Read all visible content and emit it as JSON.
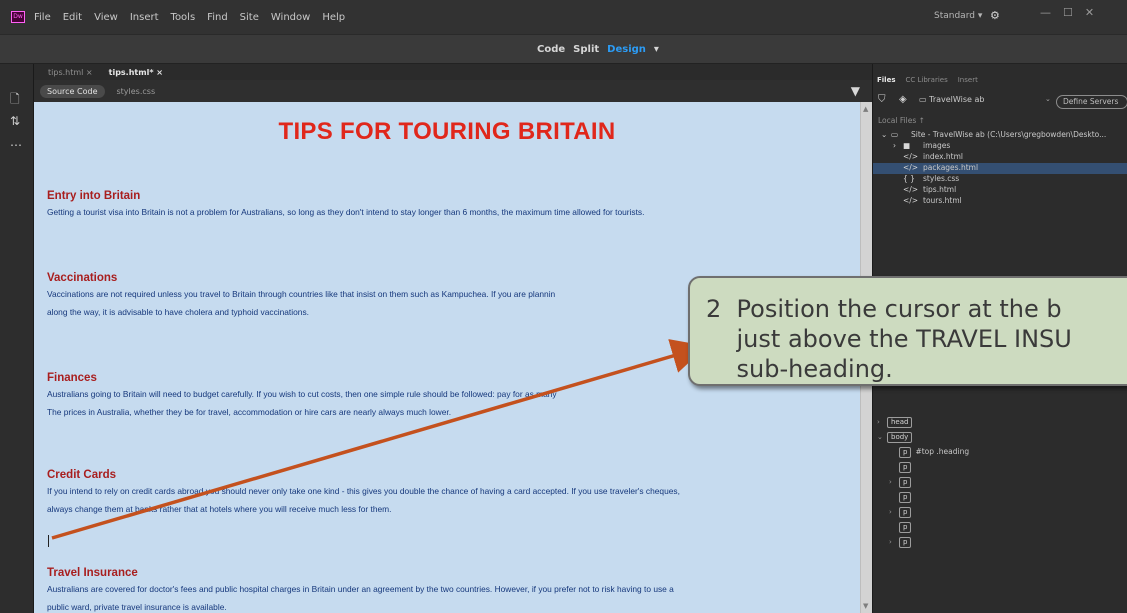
{
  "menubar": {
    "logo": "Dw",
    "items": [
      "File",
      "Edit",
      "View",
      "Insert",
      "Tools",
      "Find",
      "Site",
      "Window",
      "Help"
    ],
    "workspace": "Standard",
    "gear": "⚙"
  },
  "viewbar": {
    "code": "Code",
    "split": "Split",
    "design": "Design"
  },
  "doc": {
    "tabs": [
      "tips.html",
      "tips.html*"
    ],
    "related": {
      "source": "Source Code",
      "styles": "styles.css"
    },
    "title": "TIPS FOR TOURING BRITAIN",
    "sections": [
      {
        "heading": "Entry into Britain",
        "lines": [
          "Getting a tourist visa into Britain is not a problem for Australians, so long as they don't intend to stay longer than 6 months, the maximum time allowed for tourists."
        ]
      },
      {
        "heading": "Vaccinations",
        "lines": [
          "Vaccinations are not required unless you travel to Britain through countries like that insist on them such as Kampuchea. If you are plannin",
          "along the way, it is advisable to have cholera and typhoid vaccinations."
        ]
      },
      {
        "heading": "Finances",
        "lines": [
          "Australians going to Britain will need to budget carefully. If you wish to cut costs, then one simple rule should be followed: pay for as many",
          "The prices in Australia, whether they be for travel, accommodation or hire cars are nearly always much lower."
        ]
      },
      {
        "heading": "Credit Cards",
        "lines": [
          "If you intend to rely on credit cards abroad you should never only take one kind - this gives you double the chance of having a card accepted. If you use traveler's cheques,",
          "always change them at banks rather that at hotels where you will receive much less for them."
        ]
      },
      {
        "heading": "Travel Insurance",
        "lines": [
          "Australians are covered for doctor's fees and public hospital charges in Britain under an agreement by the two countries. However, if you prefer not to risk having to use a",
          "public ward, private travel insurance is available."
        ]
      }
    ]
  },
  "panel": {
    "tabs": [
      "Files",
      "CC Libraries",
      "Insert"
    ],
    "site": "TravelWise ab",
    "define_servers": "Define Servers",
    "local_files": "Local Files ↑",
    "tree": [
      {
        "icon": "▭",
        "label": "Site - TravelWise ab (C:\\Users\\gregbowden\\Deskto...",
        "depth": 0,
        "expand": "⌄"
      },
      {
        "icon": "■",
        "label": "images",
        "depth": 1,
        "expand": "›"
      },
      {
        "icon": "</>",
        "label": "index.html",
        "depth": 1,
        "expand": ""
      },
      {
        "icon": "</>",
        "label": "packages.html",
        "depth": 1,
        "expand": "",
        "selected": true
      },
      {
        "icon": "{ }",
        "label": "styles.css",
        "depth": 1,
        "expand": ""
      },
      {
        "icon": "</>",
        "label": "tips.html",
        "depth": 1,
        "expand": ""
      },
      {
        "icon": "</>",
        "label": "tours.html",
        "depth": 1,
        "expand": ""
      }
    ],
    "dom": [
      {
        "tag": "head",
        "extra": "",
        "arrow": "›",
        "indent": 0
      },
      {
        "tag": "body",
        "extra": "",
        "arrow": "⌄",
        "indent": 0
      },
      {
        "tag": "p",
        "extra": "#top .heading",
        "arrow": "",
        "indent": 1
      },
      {
        "tag": "p",
        "extra": "",
        "arrow": "",
        "indent": 1
      },
      {
        "tag": "p",
        "extra": "",
        "arrow": "›",
        "indent": 1
      },
      {
        "tag": "p",
        "extra": "",
        "arrow": "",
        "indent": 1
      },
      {
        "tag": "p",
        "extra": "",
        "arrow": "›",
        "indent": 1
      },
      {
        "tag": "p",
        "extra": "",
        "arrow": "",
        "indent": 1
      },
      {
        "tag": "p",
        "extra": "",
        "arrow": "›",
        "indent": 1
      }
    ]
  },
  "callout": {
    "text": "2  Position the cursor at the b\n    just above the TRAVEL INSU\n    sub-heading."
  },
  "colors": {
    "accent": "#2c9cf5",
    "title": "#e0271b",
    "heading": "#a81e1e",
    "body": "#16387c",
    "arrow": "#c4511e"
  }
}
